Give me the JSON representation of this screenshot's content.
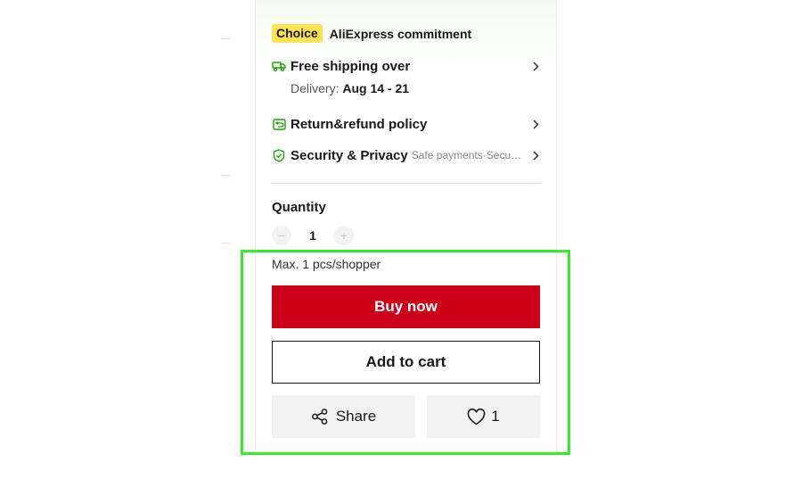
{
  "choice": {
    "badge": "Choice",
    "title": "AliExpress commitment"
  },
  "shipping": {
    "label": "Free shipping over",
    "delivery_prefix": "Delivery: ",
    "delivery_dates": "Aug 14 - 21"
  },
  "returns": {
    "label": "Return&refund policy"
  },
  "security": {
    "label": "Security & Privacy",
    "detail": "Safe payments·Secure personal details"
  },
  "quantity": {
    "label": "Quantity",
    "value": "1",
    "minus": "−",
    "plus": "+",
    "limit": "Max. 1 pcs/shopper"
  },
  "actions": {
    "buy_now": "Buy now",
    "add_to_cart": "Add to cart",
    "share": "Share",
    "wishlist_count": "1"
  },
  "colors": {
    "buy_red": "#cc0016",
    "choice_yellow": "#ffe352",
    "trust_green": "#14a800",
    "highlight": "#33ee22"
  },
  "icons": {
    "shipping": "truck-icon",
    "returns": "return-box-icon",
    "security": "shield-check-icon",
    "share": "share-icon",
    "wishlist": "heart-icon"
  }
}
